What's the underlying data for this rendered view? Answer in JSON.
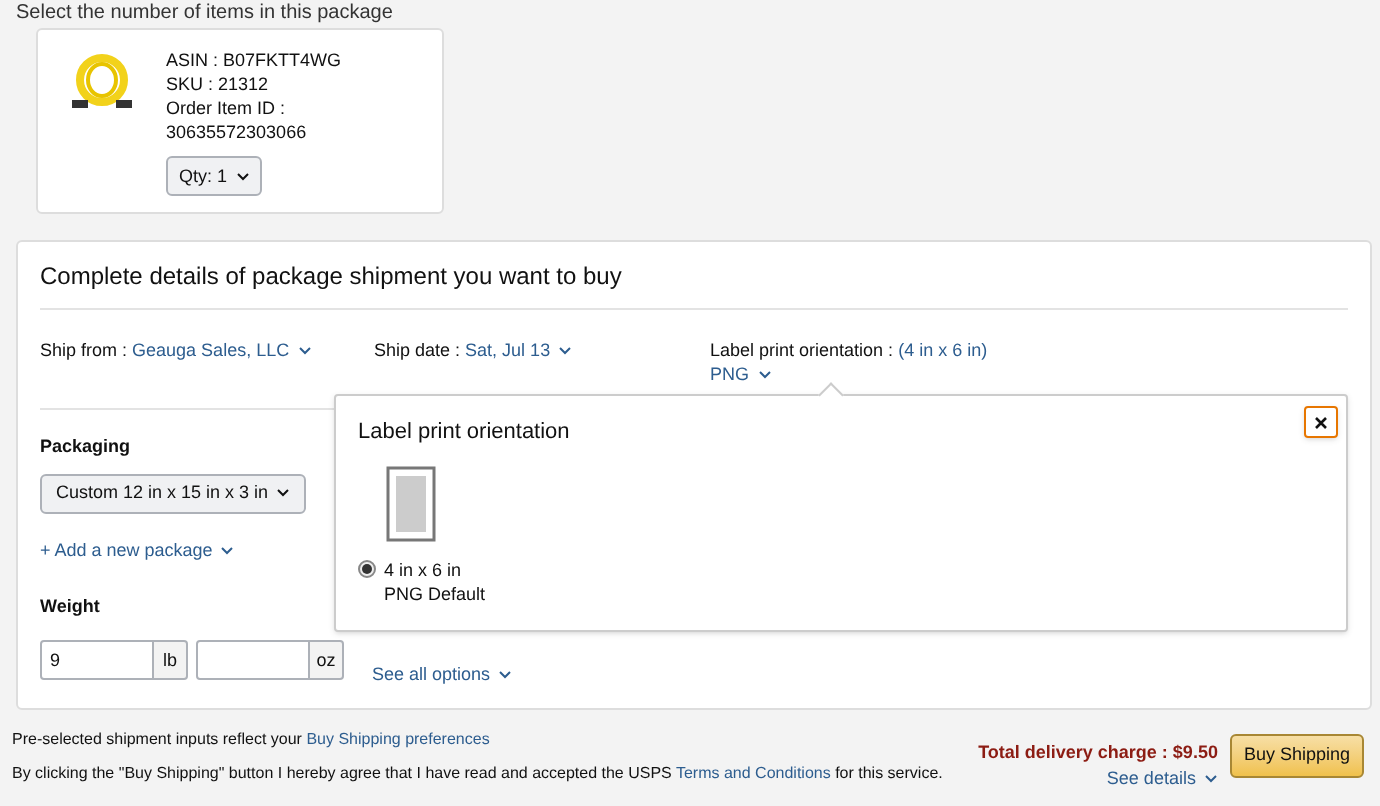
{
  "header_note": "Select the number of items in this package",
  "item": {
    "asin": "ASIN : B07FKTT4WG",
    "sku": "SKU : 21312",
    "order_item_label": "Order Item ID :",
    "order_item_id": "30635572303066",
    "qty": "Qty: 1"
  },
  "shipment": {
    "title": "Complete details of package shipment you want to buy",
    "ship_from": {
      "label": "Ship from :",
      "value": "Geauga Sales, LLC"
    },
    "ship_date": {
      "label": "Ship date :",
      "value": "Sat, Jul 13"
    },
    "orientation": {
      "label": "Label print orientation :",
      "value": "(4 in x 6 in)",
      "format": "PNG"
    },
    "packaging": {
      "label": "Packaging",
      "value": "Custom 12 in x 15 in x 3 in"
    },
    "add_package": "+ Add a new package",
    "weight": {
      "label": "Weight",
      "lb_value": "9",
      "lb_unit": "lb",
      "oz_unit": "oz"
    },
    "see_all": "See all options"
  },
  "popover": {
    "title": "Label print orientation",
    "options": [
      {
        "size": "4 in x 6 in",
        "format": "PNG Default",
        "selected": true
      }
    ]
  },
  "footer": {
    "prefs_text": "Pre-selected shipment inputs reflect your",
    "prefs_link": "Buy Shipping preferences",
    "total": "Total delivery charge : $9.50",
    "see_details": "See details",
    "buy": "Buy Shipping",
    "terms_prefix": "By clicking the \"Buy Shipping\" button I hereby agree that I have read and accepted the USPS",
    "terms_link": "Terms and Conditions",
    "terms_suffix": "for this service."
  }
}
